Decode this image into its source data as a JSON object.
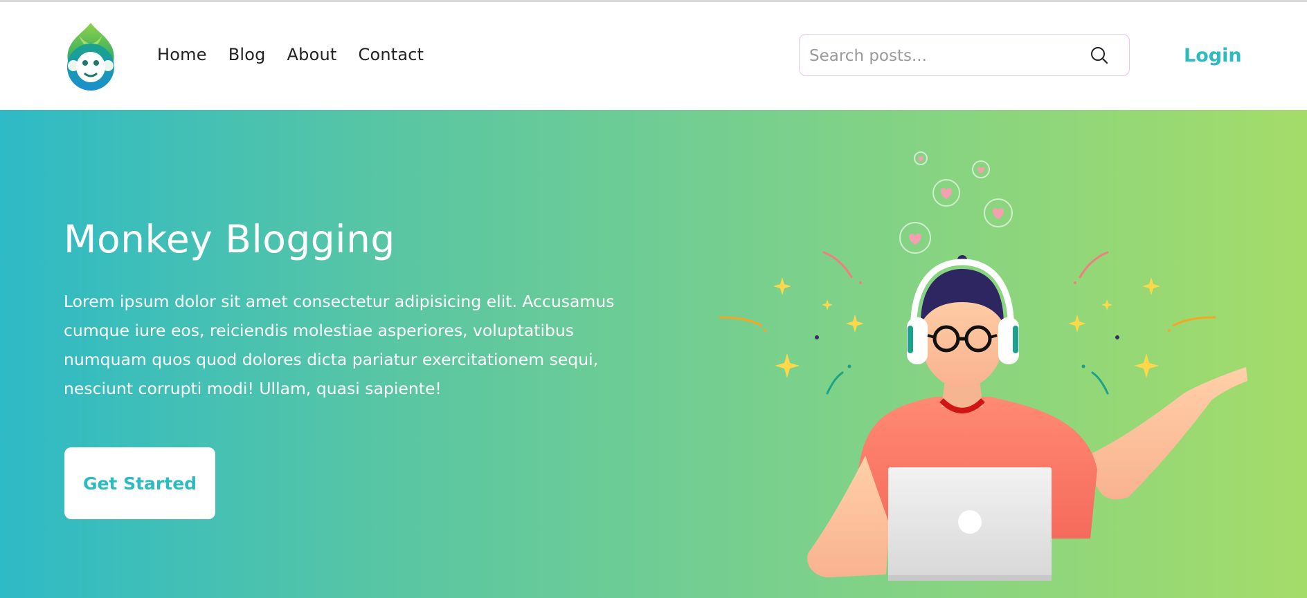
{
  "header": {
    "logo_icon": "monkey-leaf-logo",
    "nav": [
      {
        "label": "Home"
      },
      {
        "label": "Blog"
      },
      {
        "label": "About"
      },
      {
        "label": "Contact"
      }
    ],
    "search": {
      "placeholder": "Search posts...",
      "icon": "search-icon"
    },
    "login_label": "Login"
  },
  "hero": {
    "title": "Monkey Blogging",
    "description": "Lorem ipsum dolor sit amet consectetur adipisicing elit. Accusamus cumque iure eos, reiciendis molestiae asperiores, voluptatibus numquam quos quod dolores dicta pariatur exercitationem sequi, nesciunt corrupti modi! Ullam, quasi sapiente!",
    "cta_label": "Get Started",
    "illustration": "person-with-headphones-and-laptop"
  },
  "colors": {
    "accent": "#2ebac1",
    "gradient_start": "#2ebac6",
    "gradient_end": "#a4dc6a"
  }
}
